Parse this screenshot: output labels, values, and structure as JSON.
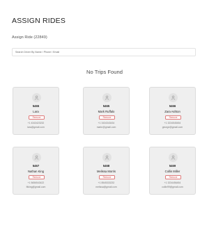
{
  "header": {
    "title": "ASSIGN RIDES",
    "subtitle": "Assign Ride (22849)"
  },
  "search": {
    "placeholder": "Search Driver By Name / Phone / Email",
    "value": ""
  },
  "trips": {
    "empty_message": "No Trips Found"
  },
  "drivers": [
    {
      "id": "5465",
      "name": "Lara",
      "remove_label": "Remove",
      "phone": "+1 4343423232",
      "email": "lara@gmail.com"
    },
    {
      "id": "5465",
      "name": "Mark Ruffalo",
      "remove_label": "Remove",
      "phone": "+1 3434343434",
      "email": "markr@gmail.com"
    },
    {
      "id": "5466",
      "name": "Zara Ashton",
      "remove_label": "Remove",
      "phone": "+1 3234545454",
      "email": "george@gmail.com"
    },
    {
      "id": "5467",
      "name": "Nathan King",
      "remove_label": "Remove",
      "phone": "+1 5656543422",
      "email": "fitking@gmail.com"
    },
    {
      "id": "5468",
      "name": "Melissa Morris",
      "remove_label": "Remove",
      "phone": "+1 8545333232",
      "email": "melissa@gmail.com"
    },
    {
      "id": "5469",
      "name": "Collin Miller",
      "remove_label": "Remove",
      "phone": "+1 3234456454",
      "email": "collin99@gmail.com"
    }
  ],
  "icons": {
    "avatar": "user-icon"
  },
  "colors": {
    "remove_accent": "#d25555",
    "card_background": "#efefef"
  }
}
